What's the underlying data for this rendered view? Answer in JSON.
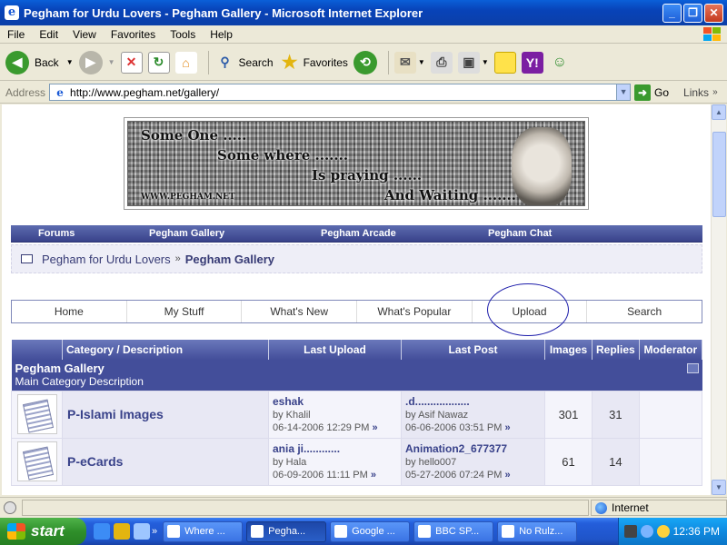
{
  "window": {
    "title": "Pegham for Urdu Lovers - Pegham Gallery - Microsoft Internet Explorer",
    "app_icon": "e",
    "min": "_",
    "max": "❐",
    "close": "✕"
  },
  "menu": [
    "File",
    "Edit",
    "View",
    "Favorites",
    "Tools",
    "Help"
  ],
  "toolbar": {
    "back": "Back",
    "search": "Search",
    "favorites": "Favorites"
  },
  "address": {
    "label": "Address",
    "url": "http://www.pegham.net/gallery/",
    "go": "Go",
    "links": "Links"
  },
  "banner": {
    "line1": "Some One .....",
    "line2": "Some where .......",
    "line3": "Is praying ......",
    "line4": "And Waiting .......",
    "url": "WWW.PEGHAM.NET"
  },
  "nav": [
    "Forums",
    "Pegham Gallery",
    "Pegham Arcade",
    "Pegham Chat"
  ],
  "breadcrumb": {
    "root": "Pegham for Urdu Lovers",
    "current": "Pegham Gallery",
    "sep": "»"
  },
  "tabs": [
    "Home",
    "My Stuff",
    "What's New",
    "What's Popular",
    "Upload",
    "Search"
  ],
  "table": {
    "headers": [
      "Category / Description",
      "Last Upload",
      "Last Post",
      "Images",
      "Replies",
      "Moderator"
    ],
    "section": {
      "name": "Pegham Gallery",
      "desc": "Main Category Description"
    },
    "rows": [
      {
        "name": "P-Islami Images",
        "upload_title": "eshak",
        "upload_by": "by Khalil",
        "upload_date": "06-14-2006 12:29 PM",
        "post_title": ".d..................",
        "post_by": "by Asif Nawaz",
        "post_date": "06-06-2006 03:51 PM",
        "images": "301",
        "replies": "31"
      },
      {
        "name": "P-eCards",
        "upload_title": "ania ji............",
        "upload_by": "by Hala",
        "upload_date": "06-09-2006 11:11 PM",
        "post_title": "Animation2_677377",
        "post_by": "by hello007",
        "post_date": "05-27-2006 07:24 PM",
        "images": "61",
        "replies": "14"
      }
    ],
    "arrow": "»"
  },
  "status": {
    "zone": "Internet"
  },
  "taskbar": {
    "start": "start",
    "tasks": [
      "Where ...",
      "Pegha...",
      "Google ...",
      "BBC SP...",
      "No Rulz..."
    ],
    "clock": "12:36 PM"
  }
}
